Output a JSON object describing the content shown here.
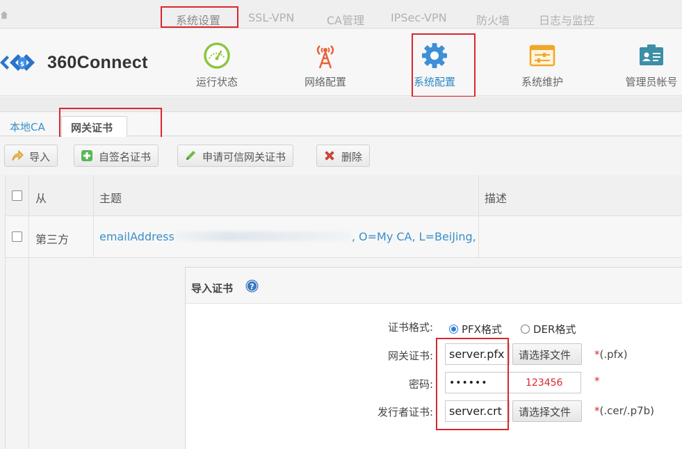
{
  "top_tabs": [
    "系统设置",
    "SSL-VPN",
    "CA管理",
    "IPSec-VPN",
    "防火墙",
    "日志与监控"
  ],
  "brand": {
    "name": "360Connect"
  },
  "nav": [
    {
      "label": "运行状态",
      "icon": "gauge-icon"
    },
    {
      "label": "网络配置",
      "icon": "network-tower-icon"
    },
    {
      "label": "系统配置",
      "icon": "gear-icon",
      "active": true
    },
    {
      "label": "系统维护",
      "icon": "maintenance-panel-icon"
    },
    {
      "label": "管理员帐号",
      "icon": "admin-id-card-icon"
    }
  ],
  "subtabs": [
    "本地CA",
    "网关证书"
  ],
  "toolbar": {
    "import": "导入",
    "self_signed": "自签名证书",
    "request_trusted": "申请可信网关证书",
    "delete": "删除"
  },
  "table": {
    "columns": [
      "从",
      "主题",
      "描述"
    ],
    "rows": [
      {
        "from": "第三方",
        "subject_prefix": "emailAddress",
        "subject_suffix": ", O=My CA, L=BeiJing,",
        "description": ""
      }
    ]
  },
  "dialog": {
    "title": "导入证书",
    "format_label": "证书格式:",
    "format_options": [
      "PFX格式",
      "DER格式"
    ],
    "format_selected": "PFX格式",
    "gateway_cert_label": "网关证书:",
    "gateway_cert_value": "server.pfx",
    "choose_file": "请选择文件",
    "gateway_cert_hint": "(.pfx)",
    "password_label": "密码:",
    "password_value": "••••••",
    "password_annotation": "123456",
    "issuer_cert_label": "发行者证书:",
    "issuer_cert_value": "server.crt",
    "issuer_cert_hint": "(.cer/.p7b)",
    "required_mark": "*"
  },
  "colors": {
    "accent_blue": "#2d88c7",
    "highlight_red": "#d9262c"
  }
}
